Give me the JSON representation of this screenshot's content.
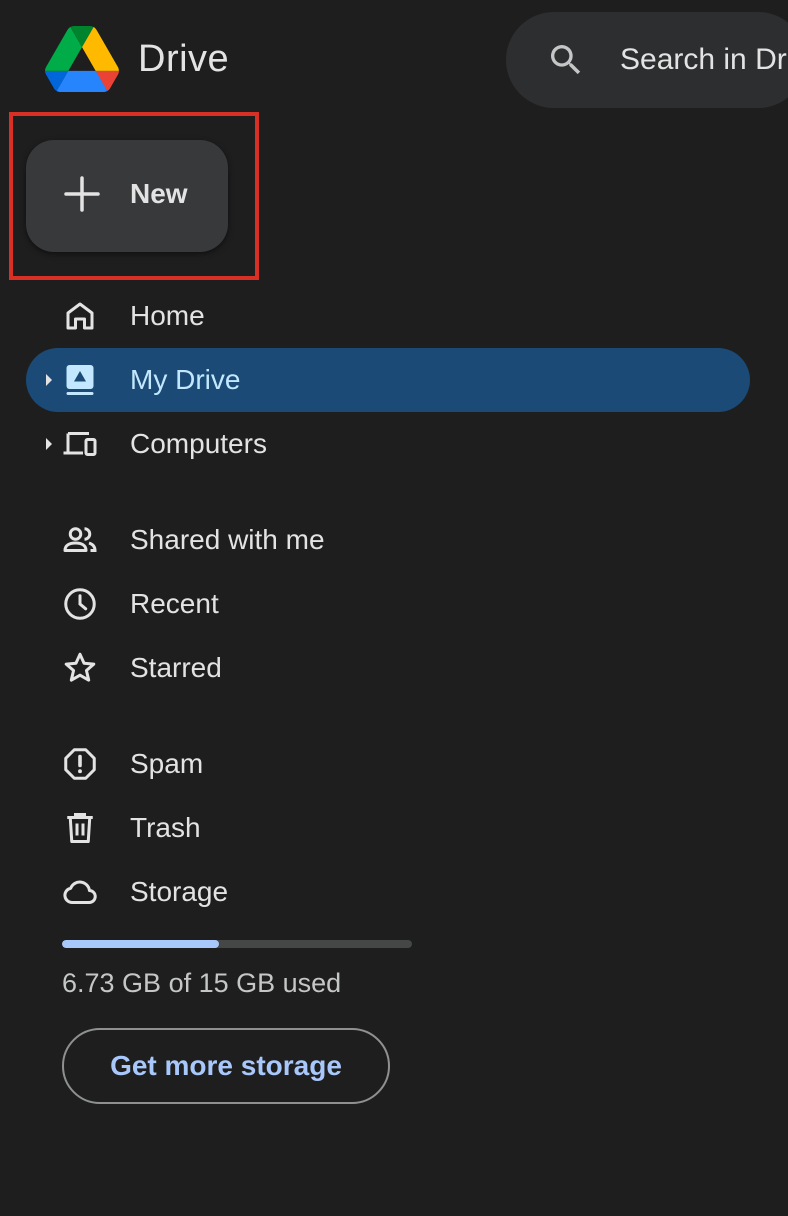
{
  "header": {
    "brand": "Drive",
    "search_placeholder": "Search in Drive"
  },
  "new_button": {
    "label": "New"
  },
  "nav": {
    "items": [
      {
        "label": "Home",
        "icon": "home-icon"
      },
      {
        "label": "My Drive",
        "icon": "my-drive-icon",
        "active": true,
        "expandable": true
      },
      {
        "label": "Computers",
        "icon": "computers-icon",
        "expandable": true
      },
      {
        "label": "Shared with me",
        "icon": "people-icon"
      },
      {
        "label": "Recent",
        "icon": "clock-icon"
      },
      {
        "label": "Starred",
        "icon": "star-icon"
      },
      {
        "label": "Spam",
        "icon": "spam-icon"
      },
      {
        "label": "Trash",
        "icon": "trash-icon"
      },
      {
        "label": "Storage",
        "icon": "cloud-icon"
      }
    ]
  },
  "storage": {
    "used_text": "6.73 GB of 15 GB used",
    "used_fraction": 0.449,
    "get_more_label": "Get more storage"
  },
  "colors": {
    "background": "#1e1e1f",
    "active_nav": "#1a4a75",
    "storage_fill": "#a8c7fa",
    "highlight": "#d93025"
  }
}
